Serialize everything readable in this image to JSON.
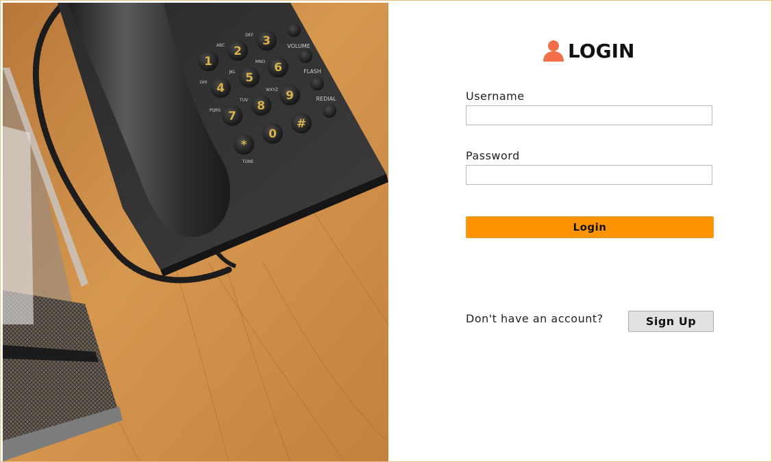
{
  "login": {
    "title": "LOGIN",
    "username_label": "Username",
    "username_value": "",
    "password_label": "Password",
    "password_value": "",
    "login_button": "Login",
    "no_account_text": "Don't have an account?",
    "signup_button": "Sign Up"
  },
  "photo": {
    "keypad": {
      "keys": [
        "1",
        "2",
        "3",
        "4",
        "5",
        "6",
        "7",
        "8",
        "9",
        "*",
        "0",
        "#"
      ],
      "letters": [
        "ABC",
        "DEF",
        "GHI",
        "JKL",
        "MNO",
        "PQRS",
        "TUV",
        "WXYZ",
        "TONE"
      ],
      "function_labels": [
        "VOLUME",
        "FLASH",
        "REDIAL"
      ]
    }
  },
  "colors": {
    "accent": "#fd9400",
    "user_icon": "#f26f4a",
    "wood": "#c88a45"
  },
  "icons": {
    "title": "user-icon"
  }
}
